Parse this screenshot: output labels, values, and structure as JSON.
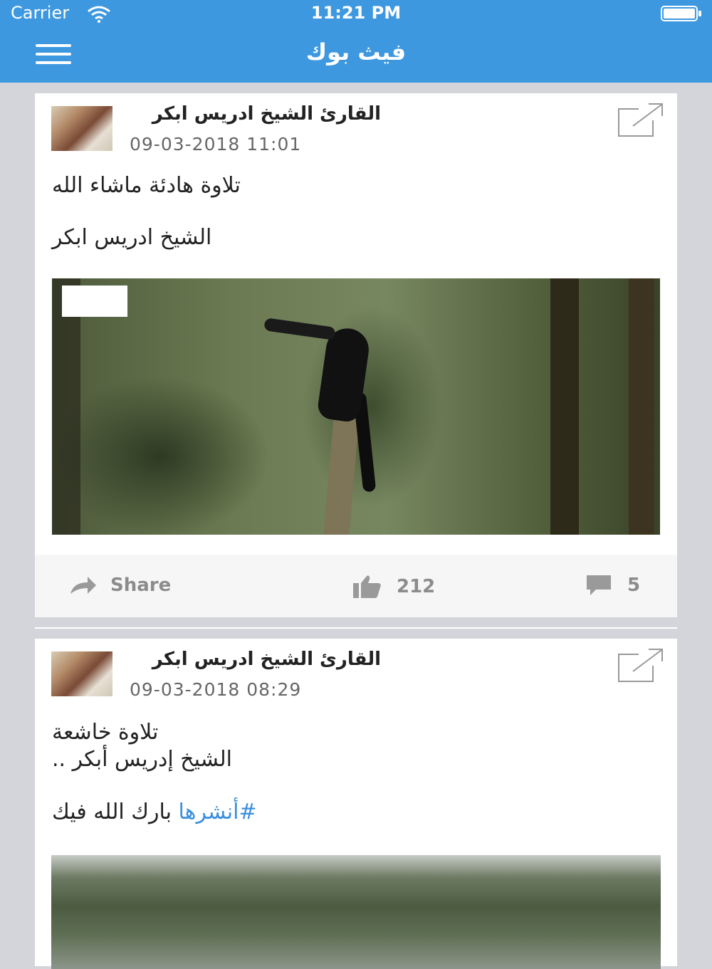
{
  "status": {
    "carrier": "Carrier",
    "time": "11:21 PM"
  },
  "header": {
    "title": "فيث بوك"
  },
  "posts": [
    {
      "author": "القارئ الشيخ ادريس ابكر",
      "date": "09-03-2018 11:01",
      "lines": [
        "تلاوة هادئة ماشاء الله",
        "الشيخ ادريس ابكر"
      ],
      "share_label": "Share",
      "likes": "212",
      "comments": "5"
    },
    {
      "author": "القارئ الشيخ ادريس ابكر",
      "date": "09-03-2018 08:29",
      "lines": [
        "تلاوة خاشعة",
        "الشيخ إدريس أبكر .."
      ],
      "hashtag": "#أنشرها",
      "line_after_tag": "بارك الله فيك"
    }
  ],
  "icons": {
    "menu": "menu-icon",
    "external": "external-link-icon",
    "share": "share-arrow-icon",
    "like": "thumbs-up-icon",
    "comment": "comment-icon"
  },
  "colors": {
    "bar": "#3d98e0",
    "hashtag": "#3b8fde",
    "background": "#d4d5da"
  }
}
